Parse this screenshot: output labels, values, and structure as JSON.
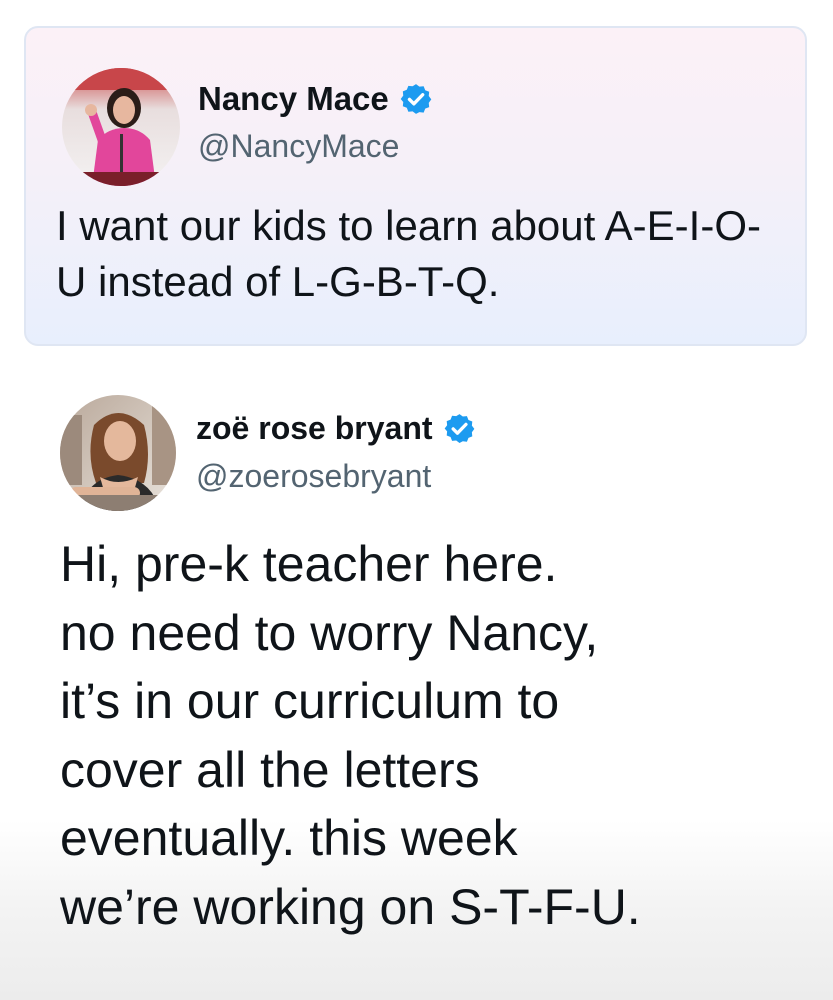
{
  "quoted_tweet": {
    "display_name": "Nancy Mace",
    "handle": "@NancyMace",
    "verified": true,
    "avatar": "avatar-photo-woman-pink-jacket",
    "text": "I want our kids to learn about A-E-I-O-U instead of L-G-B-T-Q."
  },
  "reply_tweet": {
    "display_name": "zoë rose bryant",
    "handle": "@zoerosebryant",
    "verified": true,
    "avatar": "avatar-photo-woman-brown-hair",
    "text_lines": [
      "Hi, pre-k teacher here.",
      "no need to worry Nancy,",
      "it’s in our curriculum to",
      "cover all the letters",
      "eventually. this week",
      "we’re working on S-T-F-U."
    ]
  },
  "colors": {
    "verified_badge": "#1d9bf0",
    "handle_text": "#536471",
    "body_text": "#0f1419",
    "quote_card_border": "#dfe6f3"
  }
}
